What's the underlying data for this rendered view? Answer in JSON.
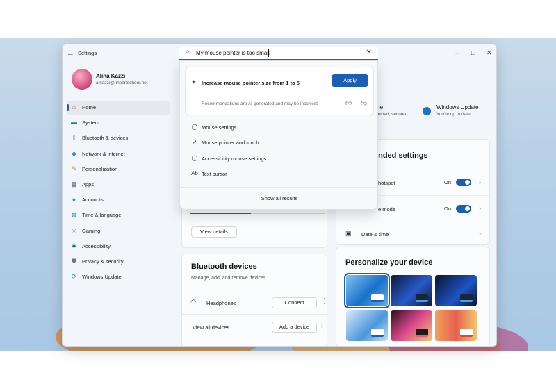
{
  "window": {
    "title": "Settings",
    "controls": {
      "minimize": "–",
      "maximize": "□",
      "close": "✕"
    }
  },
  "user": {
    "name": "Alina Kazzi",
    "email": "a.kazzi@fineartschool.net"
  },
  "sidebar": {
    "items": [
      {
        "label": "Home",
        "icon": "home-icon",
        "glyph": "⌂",
        "color": "#c06a2b"
      },
      {
        "label": "System",
        "icon": "system-icon",
        "glyph": "▬",
        "color": "#1a74c9"
      },
      {
        "label": "Bluetooth & devices",
        "icon": "bluetooth-icon",
        "glyph": "ᛒ",
        "color": "#1a74c9"
      },
      {
        "label": "Network & internet",
        "icon": "network-icon",
        "glyph": "◆",
        "color": "#2a8ad8"
      },
      {
        "label": "Personalization",
        "icon": "brush-icon",
        "glyph": "✎",
        "color": "#d4762a"
      },
      {
        "label": "Apps",
        "icon": "apps-icon",
        "glyph": "▦",
        "color": "#4a5d75"
      },
      {
        "label": "Accounts",
        "icon": "account-icon",
        "glyph": "●",
        "color": "#2aa18d"
      },
      {
        "label": "Time & language",
        "icon": "globe-icon",
        "glyph": "◍",
        "color": "#1a74c9"
      },
      {
        "label": "Gaming",
        "icon": "gamepad-icon",
        "glyph": "◎",
        "color": "#6b7580"
      },
      {
        "label": "Accessibility",
        "icon": "accessibility-icon",
        "glyph": "✱",
        "color": "#1a5fb4"
      },
      {
        "label": "Privacy & security",
        "icon": "shield-icon",
        "glyph": "⛊",
        "color": "#6b7580"
      },
      {
        "label": "Windows Update",
        "icon": "update-icon",
        "glyph": "⟳",
        "color": "#1a74c9"
      }
    ]
  },
  "search": {
    "value": "My mouse pointer is too small",
    "ai_suggestion": "Increase mouse pointer size from 1 to 5",
    "apply_label": "Apply",
    "disclaimer": "Recommendations are AI-generated and may be incorrect.",
    "results": [
      {
        "label": "Mouse settings",
        "icon": "mouse-icon",
        "glyph": "◯"
      },
      {
        "label": "Mouse pointer and touch",
        "icon": "pointer-icon",
        "glyph": "➚"
      },
      {
        "label": "Accessibility mouse settings",
        "icon": "mouse-icon",
        "glyph": "◯"
      },
      {
        "label": "Text cursor",
        "icon": "text-cursor-icon",
        "glyph": "Ab"
      }
    ],
    "show_all": "Show all results"
  },
  "status": {
    "left_title": "me",
    "left_sub": "nected, secured",
    "right_title": "Windows Update",
    "right_sub": "You're up to date"
  },
  "recommended": {
    "title": "ended settings",
    "rows": [
      {
        "label": "hotspot",
        "state": "On"
      },
      {
        "label": "e mode",
        "state": "On"
      },
      {
        "label": "Date & time"
      }
    ]
  },
  "storage": {
    "button": "View details",
    "progress": 0.45
  },
  "bluetooth": {
    "title": "Bluetooth devices",
    "subtitle": "Manage, add, and remove devices",
    "device": "Headphones",
    "connect": "Connect",
    "view_all": "View all devices",
    "add": "Add a device"
  },
  "personalize": {
    "title": "Personalize your device"
  }
}
